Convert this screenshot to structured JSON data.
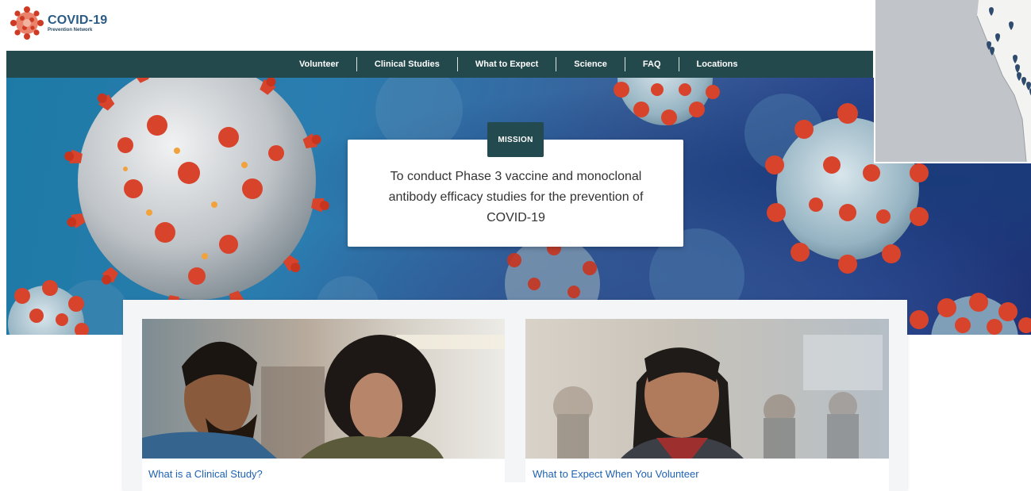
{
  "header": {
    "logo_title": "COVID-19",
    "logo_subtitle": "Prevention Network"
  },
  "nav": {
    "items": [
      {
        "label": "Volunteer"
      },
      {
        "label": "Clinical Studies"
      },
      {
        "label": "What to Expect"
      },
      {
        "label": "Science"
      },
      {
        "label": "FAQ"
      },
      {
        "label": "Locations"
      }
    ]
  },
  "hero": {
    "badge": "MISSION",
    "text": "To conduct Phase 3 vaccine and monoclonal antibody efficacy studies for the prevention of COVID-19"
  },
  "cards": [
    {
      "title": "What is a Clinical Study?"
    },
    {
      "title": "What to Expect When You Volunteer"
    }
  ],
  "colors": {
    "nav_bg": "#24494d",
    "link": "#1e62b3",
    "virus_spike": "#d8432c"
  },
  "icons": {
    "logo": "virus-logo-icon",
    "map_marker": "map-marker-icon"
  }
}
